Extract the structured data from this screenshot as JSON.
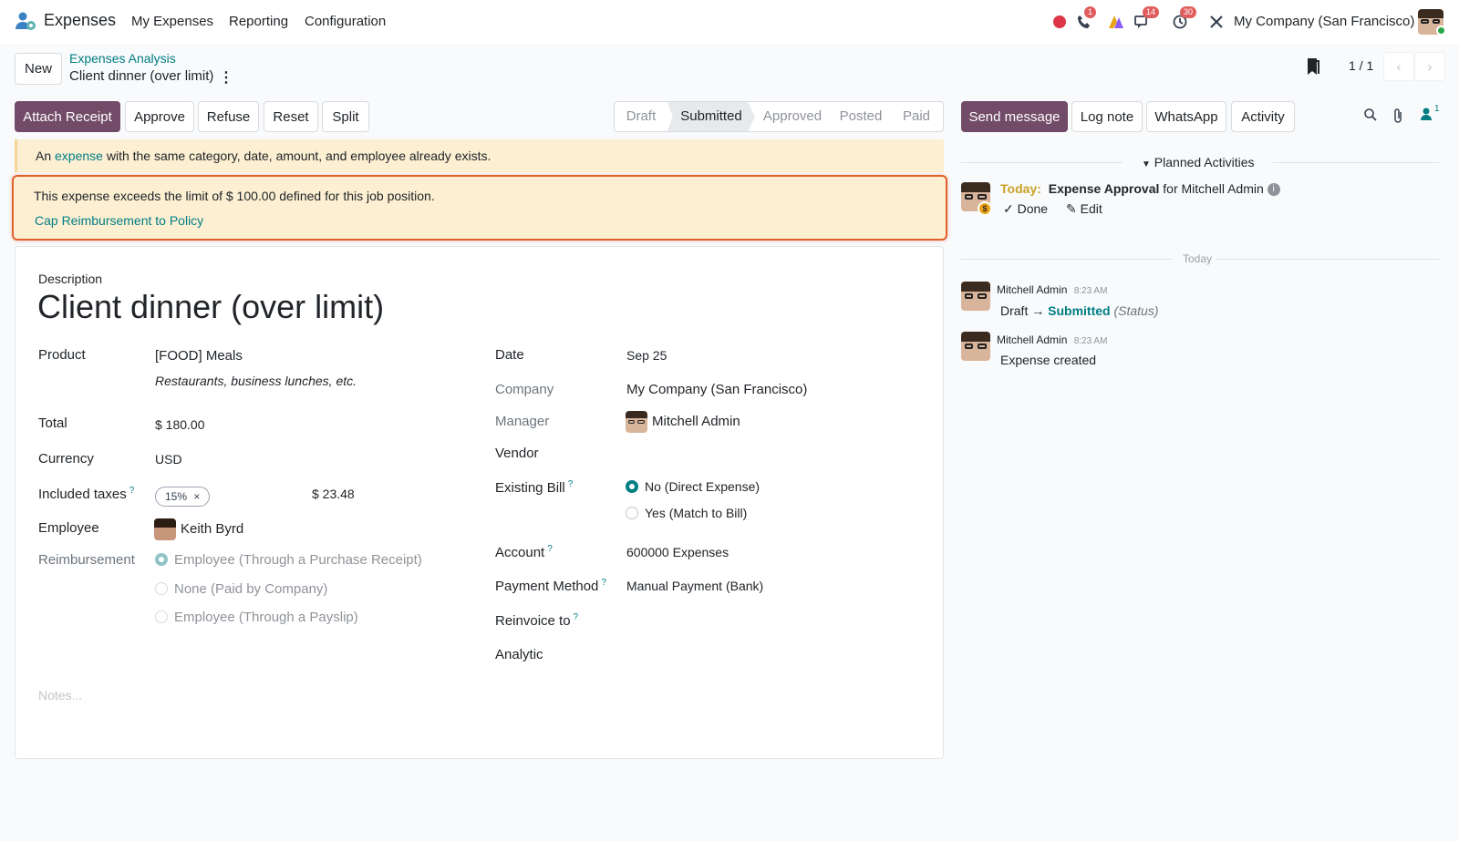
{
  "navbar": {
    "app_name": "Expenses",
    "menu": [
      "My Expenses",
      "Reporting",
      "Configuration"
    ],
    "badges": {
      "phone": "1",
      "messages": "14",
      "activities": "30"
    },
    "company": "My Company (San Francisco)"
  },
  "control": {
    "new_label": "New",
    "breadcrumb": "Expenses Analysis",
    "record_title": "Client dinner (over limit)",
    "pager": "1 / 1"
  },
  "actions": {
    "attach_receipt": "Attach Receipt",
    "approve": "Approve",
    "refuse": "Refuse",
    "reset": "Reset",
    "split": "Split"
  },
  "statusbar": {
    "stages": [
      "Draft",
      "Submitted",
      "Approved",
      "Posted",
      "Paid"
    ],
    "active": "Submitted"
  },
  "alerts": {
    "duplicate_prefix": "An",
    "duplicate_link": "expense",
    "duplicate_suffix": "with the same category, date, amount, and employee already exists.",
    "limit_message": "This expense exceeds the limit of $ 100.00 defined for this job position.",
    "cap_link": "Cap Reimbursement to Policy"
  },
  "form": {
    "description_label": "Description",
    "description": "Client dinner (over limit)",
    "product_label": "Product",
    "product": "[FOOD] Meals",
    "product_desc": "Restaurants, business lunches, etc.",
    "total_label": "Total",
    "total": "$ 180.00",
    "currency_label": "Currency",
    "currency": "USD",
    "taxes_label": "Included taxes",
    "tax_tag": "15%",
    "tax_amount": "$ 23.48",
    "employee_label": "Employee",
    "employee": "Keith Byrd",
    "reimbursement_label": "Reimbursement",
    "reimbursement_options": [
      "Employee (Through a Purchase Receipt)",
      "None (Paid by Company)",
      "Employee (Through a Payslip)"
    ],
    "date_label": "Date",
    "date": "Sep 25",
    "company_label": "Company",
    "company": "My Company (San Francisco)",
    "manager_label": "Manager",
    "manager": "Mitchell Admin",
    "vendor_label": "Vendor",
    "existing_bill_label": "Existing Bill",
    "existing_bill_options": [
      "No (Direct Expense)",
      "Yes (Match to Bill)"
    ],
    "account_label": "Account",
    "account": "600000 Expenses",
    "payment_method_label": "Payment Method",
    "payment_method": "Manual Payment (Bank)",
    "reinvoice_label": "Reinvoice to",
    "analytic_label": "Analytic",
    "notes_placeholder": "Notes..."
  },
  "chatter": {
    "send_message": "Send message",
    "log_note": "Log note",
    "whatsapp": "WhatsApp",
    "activity": "Activity",
    "follower_count": "1",
    "planned_activities": "Planned Activities",
    "activity_today": "Today:",
    "activity_title": "Expense Approval",
    "activity_for": "for Mitchell Admin",
    "done": "Done",
    "edit": "Edit",
    "date_divider": "Today",
    "messages": [
      {
        "author": "Mitchell Admin",
        "time": "8:23 AM",
        "from": "Draft",
        "to": "Submitted",
        "field": "(Status)"
      },
      {
        "author": "Mitchell Admin",
        "time": "8:23 AM",
        "body": "Expense created"
      }
    ]
  },
  "colors": {
    "primary": "#714b67",
    "link": "#017e84",
    "warning_bg": "#fcefd2",
    "highlight_border": "#e0602c",
    "today": "#c9a227"
  }
}
